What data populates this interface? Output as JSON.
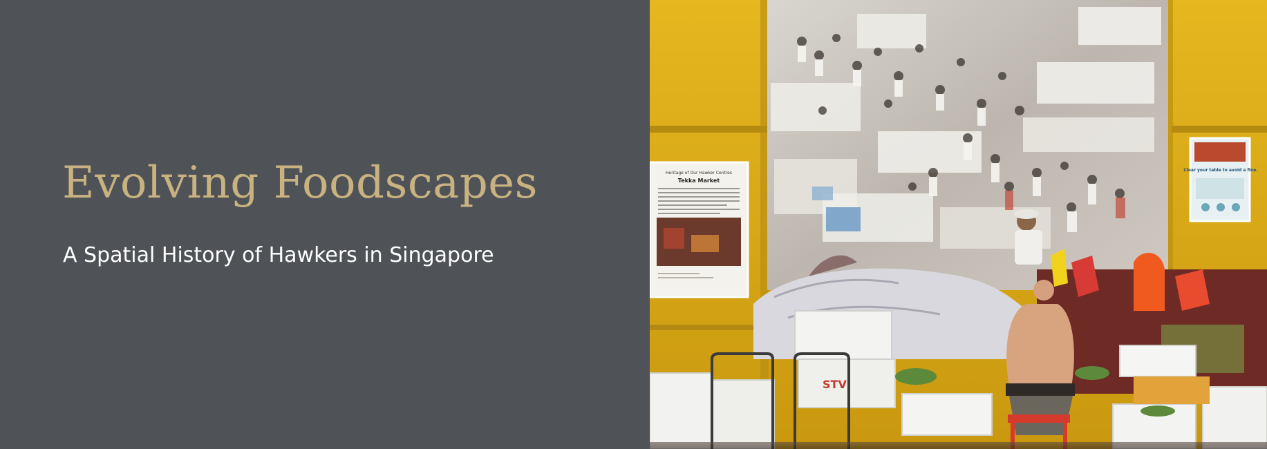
{
  "hero": {
    "title": "Evolving Foodscapes",
    "subtitle": "A Spatial History of Hawkers in Singapore",
    "background_color": "#4f5358",
    "title_color": "#c8b27f",
    "subtitle_color": "#ffffff"
  },
  "photo": {
    "icon": "hawker-market-photo",
    "wall_color": "#e0b219",
    "left_poster": {
      "heading": "Heritage of Our Hawker Centres",
      "title": "Tekka Market"
    },
    "right_poster": {
      "title": "Clear your table to avoid a fine."
    },
    "box_label": "STV"
  }
}
